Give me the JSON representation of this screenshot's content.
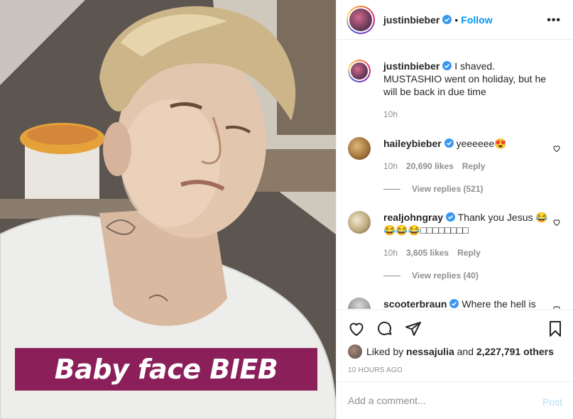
{
  "post": {
    "caption_sticker": "Baby face BIEB"
  },
  "header": {
    "username": "justinbieber",
    "separator": "•",
    "follow_label": "Follow",
    "more_icon": "more-options-icon"
  },
  "comments": [
    {
      "username": "justinbieber",
      "text": "I shaved. MUSTASHIO went on holiday, but he will be back in due time",
      "time": "10h"
    },
    {
      "username": "haileybieber",
      "text": "yeeeeee😍",
      "time": "10h",
      "likes": "20,690 likes",
      "reply": "Reply",
      "view_replies": "View replies (521)"
    },
    {
      "username": "realjohngray",
      "text": "Thank you Jesus 😂😂😂😂□□□□□□□□",
      "time": "10h",
      "likes": "3,605 likes",
      "reply": "Reply",
      "view_replies": "View replies (40)"
    },
    {
      "username": "scooterbraun",
      "text": "Where the hell is"
    }
  ],
  "actions": {
    "liked_by_prefix": "Liked by",
    "liked_by_user": "nessajulia",
    "liked_by_and": "and",
    "liked_by_others": "2,227,791 others",
    "timestamp": "10 HOURS AGO"
  },
  "add_comment": {
    "placeholder": "Add a comment...",
    "post_label": "Post"
  },
  "colors": {
    "accent": "#0095f6",
    "sticker": "#8b1f5a",
    "muted": "#8e8e8e"
  }
}
